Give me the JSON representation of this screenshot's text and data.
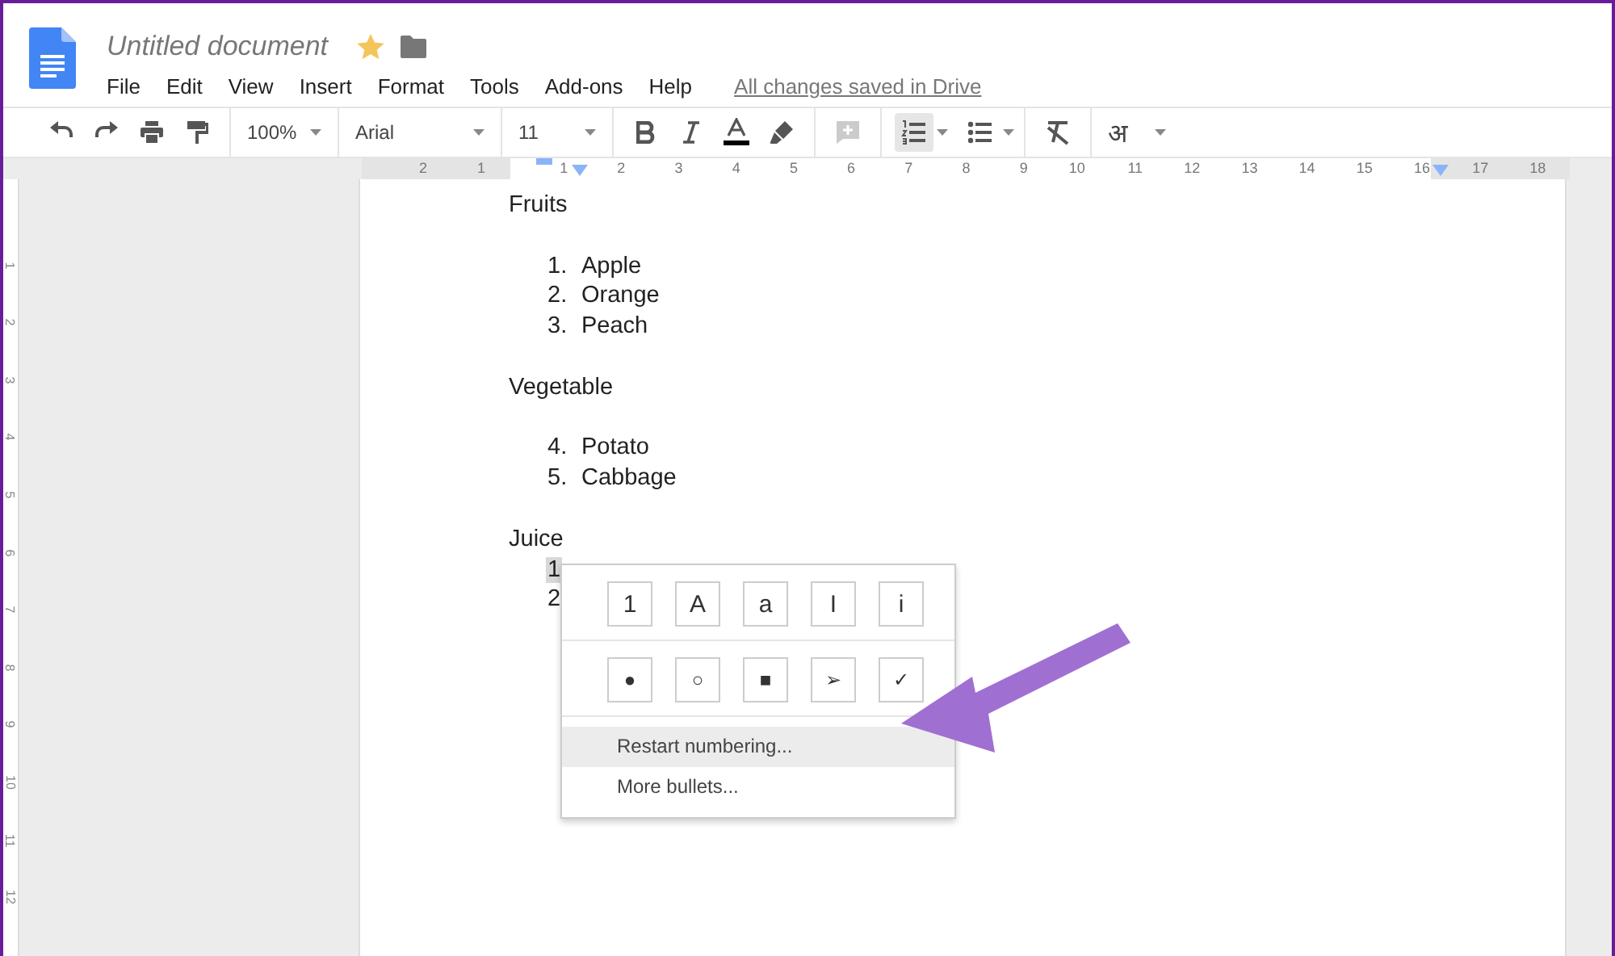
{
  "document_header": {
    "title": "Untitled document",
    "starred": true
  },
  "menu_bar": [
    "File",
    "Edit",
    "View",
    "Insert",
    "Format",
    "Tools",
    "Add-ons",
    "Help"
  ],
  "save_status": "All changes saved in Drive",
  "toolbar": {
    "zoom": "100%",
    "font": "Arial",
    "font_size": "11",
    "comment_disabled": true,
    "numbered_list_selected": true,
    "bulleted_list_selected": false,
    "input_tools": "अ"
  },
  "ruler": {
    "left_numbers": [
      "2",
      "1"
    ],
    "numbers": [
      "1",
      "2",
      "3",
      "4",
      "5",
      "6",
      "7",
      "8",
      "9",
      "10",
      "11",
      "12",
      "13",
      "14",
      "15",
      "16",
      "17",
      "18"
    ],
    "vertical_numbers": [
      "1",
      "2",
      "3",
      "4",
      "5",
      "6",
      "7",
      "8",
      "9",
      "10",
      "11",
      "12"
    ]
  },
  "document": {
    "blocks": [
      {
        "kind": "paragraph",
        "text": "Fruits"
      },
      {
        "kind": "blank"
      },
      {
        "kind": "list",
        "items": [
          {
            "number": "1.",
            "text": "Apple",
            "highlighted": false
          },
          {
            "number": "2.",
            "text": "Orange",
            "highlighted": false
          },
          {
            "number": "3.",
            "text": "Peach",
            "highlighted": false
          }
        ]
      },
      {
        "kind": "blank"
      },
      {
        "kind": "paragraph",
        "text": "Vegetable"
      },
      {
        "kind": "blank"
      },
      {
        "kind": "list",
        "items": [
          {
            "number": "4.",
            "text": "Potato",
            "highlighted": false
          },
          {
            "number": "5.",
            "text": "Cabbage",
            "highlighted": false
          }
        ]
      },
      {
        "kind": "blank"
      },
      {
        "kind": "paragraph",
        "text": "Juice"
      },
      {
        "kind": "list",
        "items": [
          {
            "number": "1",
            "highlighted": true
          },
          {
            "number": "2",
            "highlighted": false
          }
        ]
      }
    ]
  },
  "list_menu": {
    "number_styles": [
      "1",
      "A",
      "a",
      "I",
      "i"
    ],
    "bullet_styles": [
      "●",
      "○",
      "■",
      "➢",
      "✓"
    ],
    "items": [
      {
        "label": "Restart numbering...",
        "selected": true
      },
      {
        "label": "More bullets...",
        "selected": false
      }
    ]
  }
}
